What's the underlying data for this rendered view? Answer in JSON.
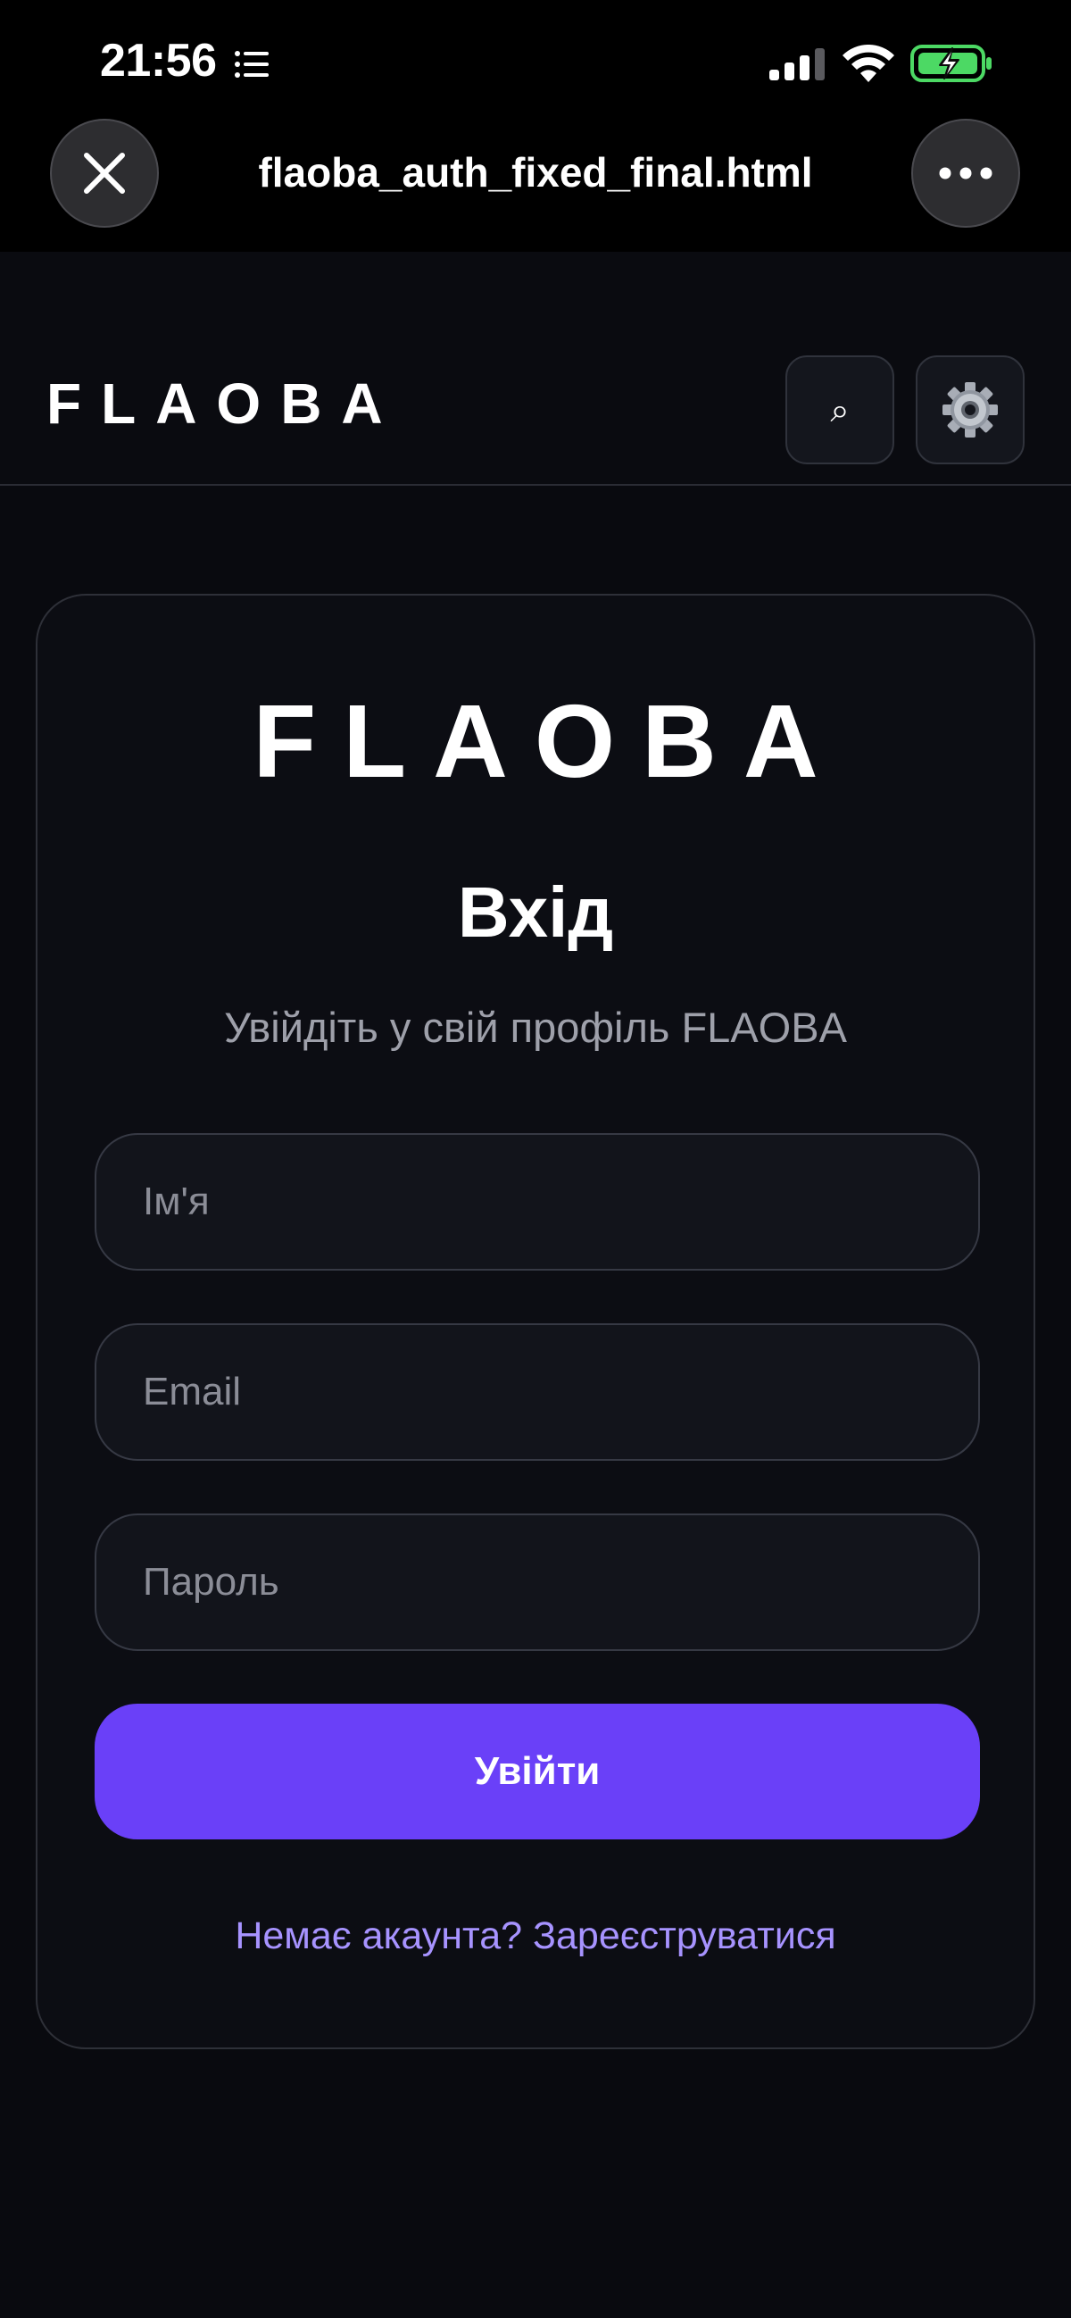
{
  "status_bar": {
    "time": "21:56",
    "icons": [
      "list-icon",
      "signal-icon",
      "wifi-icon",
      "battery-charging-icon"
    ]
  },
  "browser": {
    "title": "flaoba_auth_fixed_final.html",
    "close_icon": "close-icon",
    "more_icon": "more-icon"
  },
  "header": {
    "logo": "FLAOBA",
    "search_icon": "⌕",
    "settings_icon": "⚙️"
  },
  "auth": {
    "logo": "FLAOBA",
    "title": "Вхід",
    "subtitle": "Увійдіть у свій профіль FLAOBA",
    "name_placeholder": "Ім'я",
    "email_placeholder": "Email",
    "password_placeholder": "Пароль",
    "submit_label": "Увійти",
    "register_link": "Немає акаунта? Зареєструватися"
  },
  "colors": {
    "accent": "#6a40f8",
    "link": "#a793ff",
    "background": "#090a0f",
    "charging": "#4cd964"
  }
}
